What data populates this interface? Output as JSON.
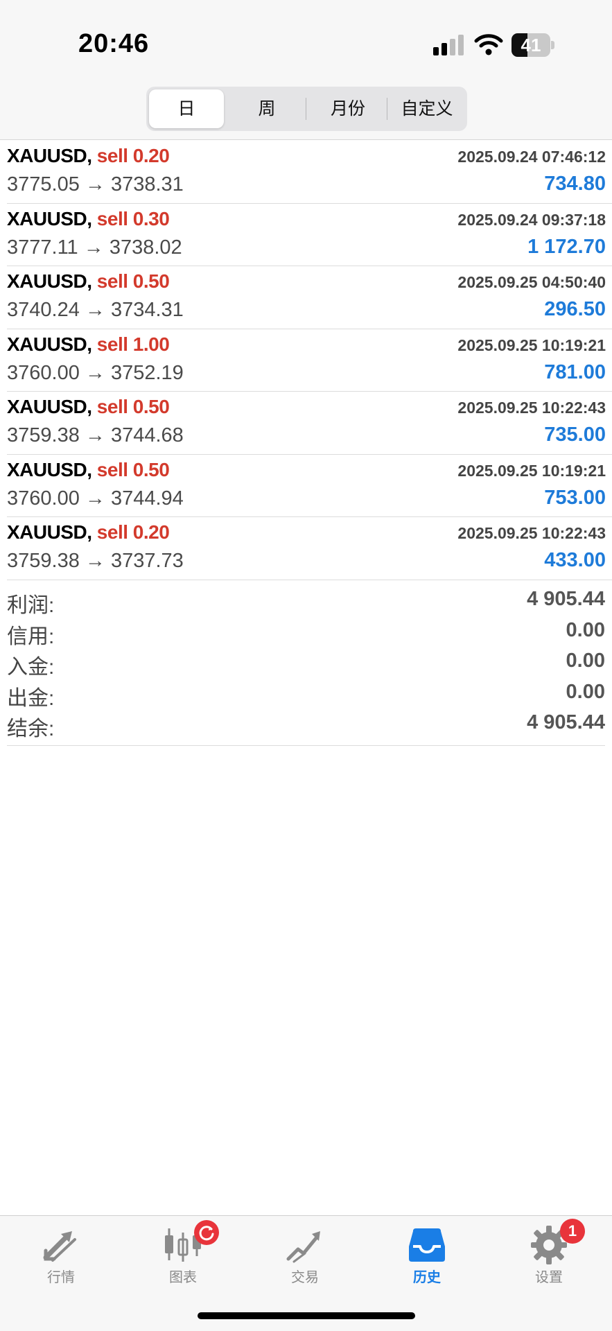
{
  "status_bar": {
    "time": "20:46",
    "battery": "41"
  },
  "period_tabs": [
    {
      "label": "日",
      "active": true
    },
    {
      "label": "周",
      "active": false
    },
    {
      "label": "月份",
      "active": false
    },
    {
      "label": "自定义",
      "active": false
    }
  ],
  "trades": [
    {
      "symbol": "XAUUSD,",
      "side": "sell",
      "volume": "0.20",
      "time": "2025.09.24 07:46:12",
      "open": "3775.05",
      "close": "3738.31",
      "arrow": "→",
      "profit": "734.80"
    },
    {
      "symbol": "XAUUSD,",
      "side": "sell",
      "volume": "0.30",
      "time": "2025.09.24 09:37:18",
      "open": "3777.11",
      "close": "3738.02",
      "arrow": "→",
      "profit": "1 172.70"
    },
    {
      "symbol": "XAUUSD,",
      "side": "sell",
      "volume": "0.50",
      "time": "2025.09.25 04:50:40",
      "open": "3740.24",
      "close": "3734.31",
      "arrow": "→",
      "profit": "296.50"
    },
    {
      "symbol": "XAUUSD,",
      "side": "sell",
      "volume": "1.00",
      "time": "2025.09.25 10:19:21",
      "open": "3760.00",
      "close": "3752.19",
      "arrow": "→",
      "profit": "781.00"
    },
    {
      "symbol": "XAUUSD,",
      "side": "sell",
      "volume": "0.50",
      "time": "2025.09.25 10:22:43",
      "open": "3759.38",
      "close": "3744.68",
      "arrow": "→",
      "profit": "735.00"
    },
    {
      "symbol": "XAUUSD,",
      "side": "sell",
      "volume": "0.50",
      "time": "2025.09.25 10:19:21",
      "open": "3760.00",
      "close": "3744.94",
      "arrow": "→",
      "profit": "753.00"
    },
    {
      "symbol": "XAUUSD,",
      "side": "sell",
      "volume": "0.20",
      "time": "2025.09.25 10:22:43",
      "open": "3759.38",
      "close": "3737.73",
      "arrow": "→",
      "profit": "433.00"
    }
  ],
  "summary": [
    {
      "label": "利润:",
      "value": "4 905.44"
    },
    {
      "label": "信用:",
      "value": "0.00"
    },
    {
      "label": "入金:",
      "value": "0.00"
    },
    {
      "label": "出金:",
      "value": "0.00"
    },
    {
      "label": "结余:",
      "value": "4 905.44"
    }
  ],
  "tabbar": [
    {
      "label": "行情",
      "icon": "quotes-arrows-icon",
      "active": false,
      "badge": ""
    },
    {
      "label": "图表",
      "icon": "candlestick-chart-icon",
      "active": false,
      "badge": "refresh"
    },
    {
      "label": "交易",
      "icon": "trade-chart-icon",
      "active": false,
      "badge": ""
    },
    {
      "label": "历史",
      "icon": "history-inbox-icon",
      "active": true,
      "badge": ""
    },
    {
      "label": "设置",
      "icon": "gear-icon",
      "active": false,
      "badge": "1"
    }
  ],
  "colors": {
    "sell": "#d33a2c",
    "profit": "#1e7bd9",
    "active_tab": "#1a7ee6",
    "badge": "#e8343b"
  }
}
